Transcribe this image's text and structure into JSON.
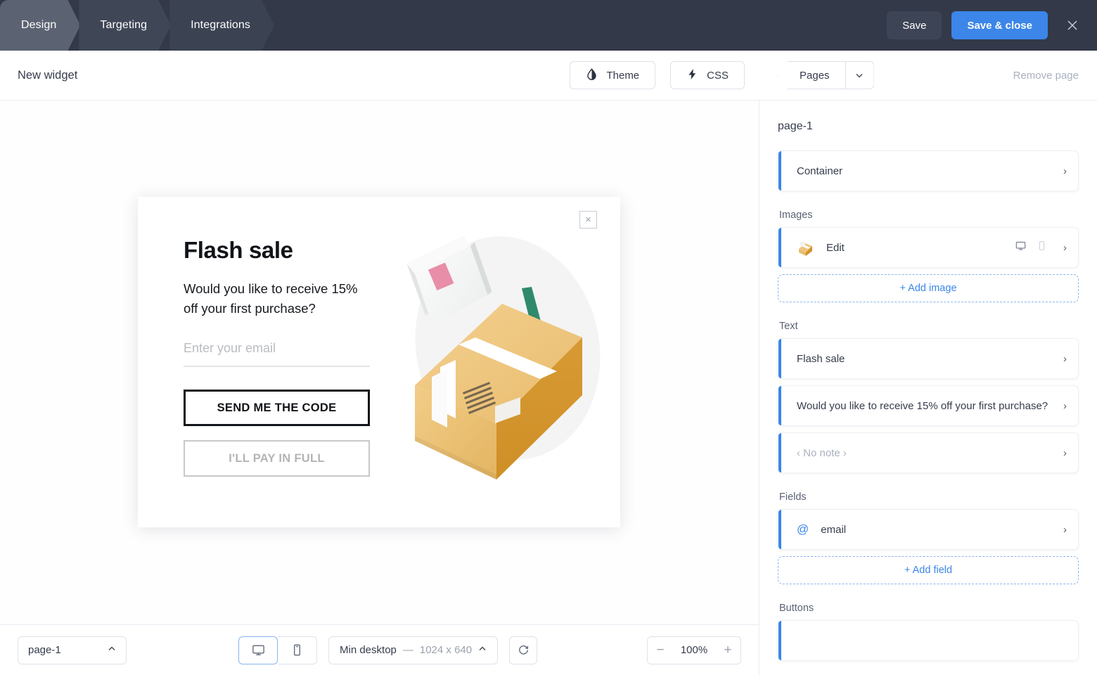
{
  "topbar": {
    "tabs": [
      {
        "label": "Design",
        "active": true
      },
      {
        "label": "Targeting",
        "active": false
      },
      {
        "label": "Integrations",
        "active": false
      }
    ],
    "save_label": "Save",
    "save_close_label": "Save & close",
    "close_icon": "close-icon",
    "accent_color": "#3b86e8",
    "bar_color": "#333949"
  },
  "subheader": {
    "widget_title": "New widget",
    "theme_label": "Theme",
    "theme_icon": "contrast-droplet-icon",
    "css_label": "CSS",
    "css_icon": "lightning-bolt-icon"
  },
  "widget": {
    "close_icon": "close-icon",
    "title": "Flash sale",
    "subtitle": "Would you like to receive 15% off your first purchase?",
    "email_placeholder": "Enter your email",
    "primary_button": "SEND ME THE CODE",
    "secondary_button": "I'LL PAY IN FULL",
    "illustration": "package-box-illustration"
  },
  "bottombar": {
    "page_select": "page-1",
    "page_caret_icon": "chevron-up-icon",
    "desktop_icon": "desktop-monitor-icon",
    "mobile_icon": "mobile-phone-icon",
    "selected_device": "desktop",
    "viewport_label": "Min desktop",
    "viewport_dash": "—",
    "viewport_dims": "1024 x 640",
    "viewport_caret_icon": "chevron-up-icon",
    "refresh_icon": "refresh-icon",
    "zoom_out_icon": "minus-icon",
    "zoom_value": "100%",
    "zoom_in_icon": "plus-icon"
  },
  "rightpanel": {
    "pages_label": "Pages",
    "pages_caret_icon": "chevron-down-icon",
    "remove_page_label": "Remove page",
    "page_label": "page-1",
    "groups": [
      {
        "label": "",
        "items": [
          {
            "label": "Container",
            "chevron": "›"
          }
        ]
      },
      {
        "label": "Images",
        "items": [
          {
            "label": "Edit",
            "chevron": "›",
            "thumb": "package-thumbnail-icon",
            "devices": true
          }
        ],
        "add_label": "+ Add image"
      },
      {
        "label": "Text",
        "items": [
          {
            "label": "Flash sale",
            "chevron": "›"
          },
          {
            "label": "Would you like to receive 15% off your first purchase?",
            "chevron": "›"
          },
          {
            "label": "‹ No note ›",
            "chevron": "›",
            "muted": true
          }
        ]
      },
      {
        "label": "Fields",
        "items": [
          {
            "label": "email",
            "chevron": "›",
            "at": "@"
          }
        ],
        "add_label": "+ Add field"
      },
      {
        "label": "Buttons",
        "items": [
          {
            "label": "",
            "chevron": ""
          }
        ]
      }
    ]
  }
}
